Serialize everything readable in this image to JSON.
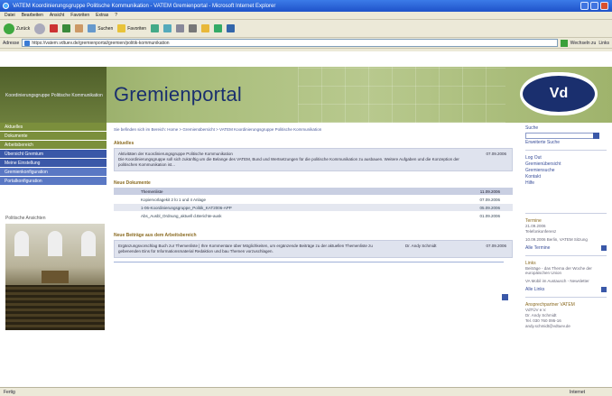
{
  "window": {
    "title": "VATEM Koordinierungsgruppe Politische Kommunikation - VATEM Gremienportal - Microsoft Internet Explorer"
  },
  "menu": [
    "Datei",
    "Bearbeiten",
    "Ansicht",
    "Favoriten",
    "Extras",
    "?"
  ],
  "toolbar": {
    "back": "Zurück",
    "search": "Suchen",
    "favorites": "Favoriten"
  },
  "address": {
    "label": "Adresse",
    "url": "https://vatem.vdtuev.de/gremienportal/gremien/politik-kommunikation",
    "go": "Wechseln zu",
    "links": "Links"
  },
  "brand": {
    "left_text": "Koordinierungsgruppe Politische Kommunikation",
    "title": "Gremienportal",
    "logo": "Vd"
  },
  "nav": [
    {
      "label": "Aktuelles",
      "style": "g"
    },
    {
      "label": "Dokumente",
      "style": "g"
    },
    {
      "label": "Arbeitsbereich",
      "style": "g"
    },
    {
      "label": "Übersicht Gremium",
      "style": "b"
    },
    {
      "label": "Meine Einstellung",
      "style": "b"
    },
    {
      "label": "Gremienkonfiguration",
      "style": "lb"
    },
    {
      "label": "Portalkonfiguration",
      "style": "lb"
    }
  ],
  "side_image_label": "Politische Ansichten",
  "breadcrumb": "Sie befinden sich im Bereich: Home > Gremienübersicht > VATEM Koordinierungsgruppe Politische Kommunikation",
  "news": {
    "heading": "Aktuelles",
    "text": "Aktivitäten der Koordinierungsgruppe Politische Kommunikation\nDie Koordinierungsgruppe soll sich zukünftig um die Belange des VATEM, Bund und Wertsetzungen für die politische Kommunikation zu ausbauen. Weitere Aufgaben und die Konzeption der politischen Kommunikation ist...",
    "date": "07.09.2006"
  },
  "docs": {
    "heading": "Neue Dokumente",
    "rows": [
      {
        "name": "Themenliste",
        "date": "11.09.2006"
      },
      {
        "name": "Kopiervorlagekit 2 lü 1 und 4 Anlage",
        "date": "07.09.2006"
      },
      {
        "name": "1-06-Koordinierungsgruppe_Politik_KAT2006-APP",
        "date": "05.09.2006"
      },
      {
        "name": "Abs_Ausbl_Ordnung_aktuell d.Berichte-ausk",
        "date": "01.09.2006"
      }
    ]
  },
  "work": {
    "heading": "Neue Beiträge aus dem Arbeitsbereich",
    "text": "Ergänzungsvorschlag Buch zur Themenliste | Ihre Kommentare über Möglichkeiten, um ergänzende Beiträge zu der aktuellen Themenliste zu gebenenden Eins für Informationsmaterial Redaktion und bau Themen vorzuschlagen.",
    "author": "Dr. Andy Schmidt",
    "date": "07.09.2006"
  },
  "right": {
    "search_label": "Suche",
    "erweiterte": "Erweiterte Suche",
    "links": [
      "Log Out",
      "Gremienübersicht",
      "Gremiensuche",
      "Kontakt",
      "Hilfe"
    ],
    "termine_heading": "Termine",
    "termine": [
      "21.09.2006",
      "Telefonkonferenz",
      "10.09.2006 Berlin, VATEM Sitzung"
    ],
    "alle_termine": "Alle Termine",
    "links_heading": "Links",
    "link_items": [
      "Beiträge - das Thema der Woche der europäischen Union",
      "VA Mobil im Austausch - Newsletter"
    ],
    "alle_links": "Alle Links",
    "ansprech_heading": "Ansprechpartner VATEM",
    "ansprech": [
      "VdTÜV e.V.",
      "Dr. Andy Schmidt",
      "Tel. 030 760 095-16",
      "andy.schmidt@vdtuev.de"
    ]
  },
  "status": {
    "left": "Fertig",
    "right": "Internet"
  },
  "colors": {
    "title_blue": "#1a2f6e",
    "nav_green": "#7b8f3c",
    "nav_blue": "#3a58a8",
    "row_bg": "#e4e7f0",
    "banner_green": "#a9bd7b"
  }
}
